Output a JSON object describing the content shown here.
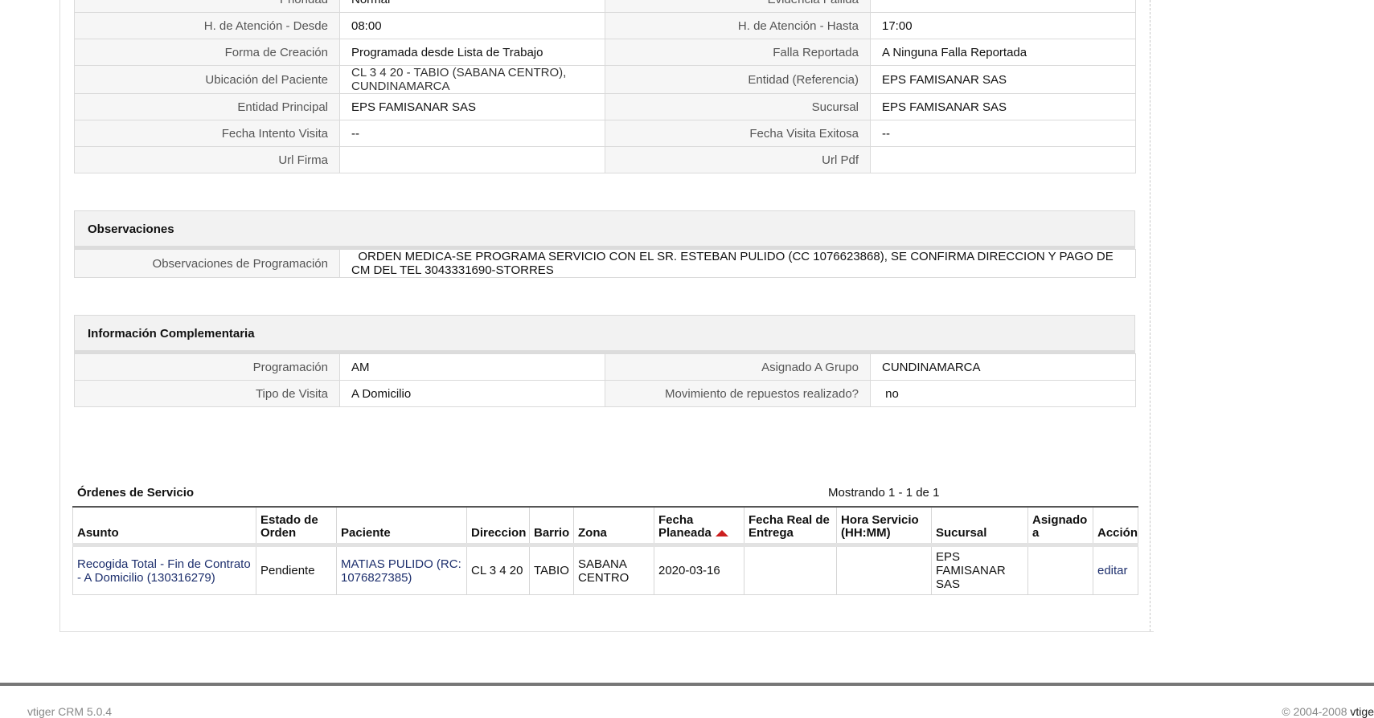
{
  "main_info": {
    "rows": [
      {
        "l1": "Prioridad",
        "v1": "Normal",
        "l2": "Evidencia Fallida",
        "v2": ""
      },
      {
        "l1": "H. de Atención - Desde",
        "v1": "08:00",
        "l2": "H. de Atención - Hasta",
        "v2": "17:00"
      },
      {
        "l1": "Forma de Creación",
        "v1": "Programada desde Lista de Trabajo",
        "l2": "Falla Reportada",
        "v2": "A Ninguna Falla Reportada"
      },
      {
        "l1": "Ubicación del Paciente",
        "v1": "CL 3 4 20 - TABIO (SABANA CENTRO), CUNDINAMARCA",
        "l2": "Entidad (Referencia)",
        "v2": "EPS FAMISANAR SAS"
      },
      {
        "l1": "Entidad Principal",
        "v1": "EPS FAMISANAR SAS",
        "l2": "Sucursal",
        "v2": "EPS FAMISANAR SAS"
      },
      {
        "l1": "Fecha Intento Visita",
        "v1": " --",
        "l2": "Fecha Visita Exitosa",
        "v2": " --"
      },
      {
        "l1": "Url Firma",
        "v1": "",
        "l2": "Url Pdf",
        "v2": ""
      }
    ]
  },
  "observaciones": {
    "header": "Observaciones",
    "label": "Observaciones de Programación",
    "value": "  ORDEN MEDICA-SE PROGRAMA SERVICIO CON EL SR. ESTEBAN PULIDO (CC 1076623868), SE CONFIRMA DIRECCION Y PAGO DE CM DEL TEL 3043331690-STORRES"
  },
  "complementaria": {
    "header": "Información Complementaria",
    "rows": [
      {
        "l1": "Programación",
        "v1": "AM",
        "l2": "Asignado A Grupo",
        "v2": "CUNDINAMARCA"
      },
      {
        "l1": "Tipo de Visita",
        "v1": "A Domicilio",
        "l2": "Movimiento de repuestos realizado?",
        "v2": " no"
      }
    ]
  },
  "ordenes": {
    "title": "Órdenes de Servicio",
    "count": "Mostrando 1 - 1 de 1",
    "columns": [
      "Asunto",
      "Estado de Orden",
      "Paciente",
      "Direccion",
      "Barrio",
      "Zona",
      "Fecha Planeada",
      "Fecha Real de Entrega",
      "Hora Servicio (HH:MM)",
      "Sucursal",
      "Asignado a",
      "Acción"
    ],
    "rows": [
      {
        "asunto": "Recogida Total - Fin de Contrato - A Domicilio (130316279)",
        "estado": "Pendiente",
        "paciente": "MATIAS PULIDO (RC: 1076827385)",
        "direccion": "CL 3 4 20",
        "barrio": "TABIO",
        "zona": "SABANA CENTRO",
        "fecha_planeada": "2020-03-16",
        "fecha_real": "",
        "hora_servicio": "",
        "sucursal": "EPS FAMISANAR SAS",
        "asignado": "",
        "accion": "editar"
      }
    ]
  },
  "footer": {
    "left": "vtiger CRM 5.0.4",
    "right_copy": "© 2004-2008 ",
    "right_brand": "vtige"
  },
  "colors": {
    "sort_arrow": "#cc1f1f",
    "link": "#1d2f6d"
  }
}
